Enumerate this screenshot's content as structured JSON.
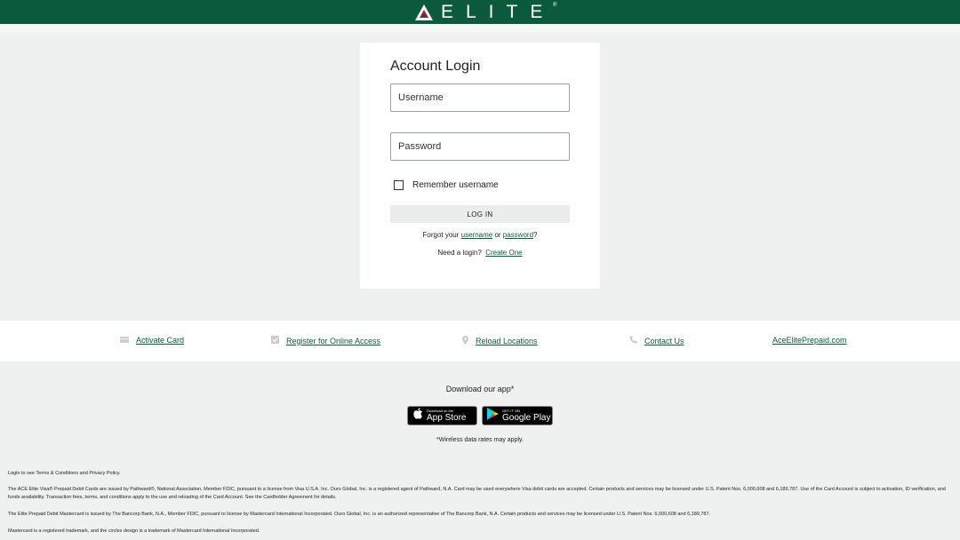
{
  "colors": {
    "brand_green": "#0b5a3c",
    "card_bg": "#ffffff",
    "page_bg": "#eef1f0"
  },
  "header": {
    "logo_text": "ELITE",
    "logo_mark": "®"
  },
  "login": {
    "title": "Account Login",
    "username_placeholder": "Username",
    "password_placeholder": "Password",
    "remember_label": "Remember username",
    "login_button": "LOG IN",
    "forgot_prefix": "Forgot your ",
    "forgot_username": "username",
    "forgot_or": " or ",
    "forgot_password": "password",
    "forgot_suffix": "?",
    "need_login": "Need a login?",
    "create_one": "Create One"
  },
  "links": [
    {
      "label": "Activate Card",
      "icon": "card-icon"
    },
    {
      "label": "Register for Online Access",
      "icon": "checkbox-icon"
    },
    {
      "label": "Reload Locations",
      "icon": "location-pin-icon"
    },
    {
      "label": "Contact Us",
      "icon": "phone-icon"
    },
    {
      "label": "AceElitePrepaid.com",
      "icon": ""
    }
  ],
  "app": {
    "download_text": "Download our app*",
    "apple_small": "Download on the",
    "apple_big": "App Store",
    "google_small": "GET IT ON",
    "google_big": "Google Play",
    "wireless_note": "*Wireless data rates may apply."
  },
  "legal": {
    "line1": "Login to see Terms & Conditions and Privacy Policy.",
    "line2": "The ACE Elite Visa® Prepaid Debit Cards are issued by Pathward®, National Association, Member FDIC, pursuant to a license from Visa U.S.A. Inc. Ouro Global, Inc. is a registered agent of Pathward, N.A. Card may be used everywhere Visa debit cards are accepted. Certain products and services may be licensed under U.S. Patent Nos. 6,000,608 and 6,189,787. Use of the Card Account is subject to activation, ID verification, and funds availability. Transaction fees, terms, and conditions apply to the use and reloading of the Card Account. See the Cardholder Agreement for details.",
    "line3": "The Elite Prepaid Debit Mastercard is issued by The Bancorp Bank, N.A., Member FDIC, pursuant to license by Mastercard International Incorporated. Ouro Global, Inc. is an authorized representative of The Bancorp Bank, N.A. Certain products and services may be licensed under U.S. Patent Nos. 6,000,608 and 6,189,787.",
    "line4": "Mastercard is a registered trademark, and the circles design is a trademark of Mastercard International Incorporated."
  }
}
